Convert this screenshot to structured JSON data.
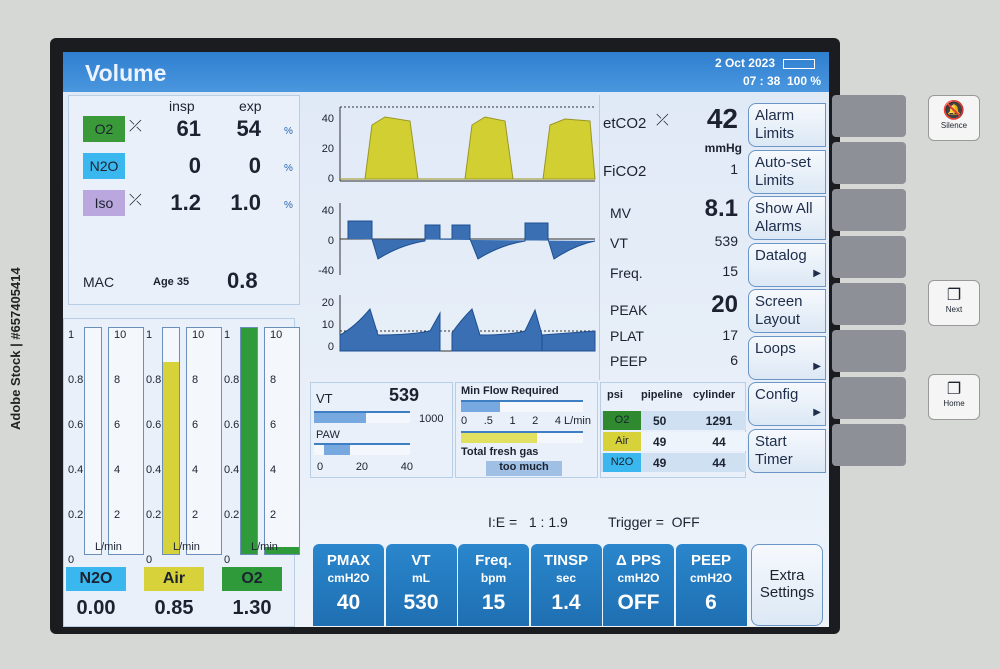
{
  "watermark": "Adobe Stock | #657405414",
  "header": {
    "title": "Volume",
    "date": "2 Oct 2023",
    "time": "07 : 38",
    "battery": "100 %"
  },
  "gases": {
    "col_insp": "insp",
    "col_exp": "exp",
    "unit": "%",
    "rows": [
      {
        "label": "O2",
        "insp": "61",
        "exp": "54",
        "color": "#3a9a3a"
      },
      {
        "label": "N2O",
        "insp": "0",
        "exp": "0",
        "color": "#39b7ee"
      },
      {
        "label": "Iso",
        "insp": "1.2",
        "exp": "1.0",
        "color": "#b9a7dd"
      }
    ],
    "mac_label": "MAC",
    "age": "Age 35",
    "mac": "0.8"
  },
  "flowmeters": {
    "unit": "L/min",
    "scale_left": [
      "1",
      "0.8",
      "0.6",
      "0.4",
      "0.2",
      "0"
    ],
    "scale_right": [
      "10",
      "8",
      "6",
      "4",
      "2"
    ],
    "tubes": [
      {
        "label": "N2O",
        "value": "0.00",
        "color": "#39b7ee",
        "level": 0
      },
      {
        "label": "Air",
        "value": "0.85",
        "color": "#d8d23a",
        "level": 0.85
      },
      {
        "label": "O2",
        "value": "1.30",
        "color": "#2f9a3a",
        "level": 1.0
      }
    ]
  },
  "waveforms": {
    "co2_ticks": [
      "40",
      "20",
      "0"
    ],
    "flow_ticks": [
      "40",
      "0",
      "-40"
    ],
    "paw_ticks": [
      "20",
      "10",
      "0"
    ]
  },
  "numerics": {
    "etco2_label": "etCO2",
    "etco2": "42",
    "etco2_unit": "mmHg",
    "fico2_label": "FiCO2",
    "fico2": "1",
    "mv_label": "MV",
    "mv": "8.1",
    "vt_label": "VT",
    "vt": "539",
    "freq_label": "Freq.",
    "freq": "15",
    "peak_label": "PEAK",
    "peak": "20",
    "plat_label": "PLAT",
    "plat": "17",
    "peep_label": "PEEP",
    "peep": "6"
  },
  "menu": [
    {
      "label": "Alarm Limits"
    },
    {
      "label": "Auto-set Limits"
    },
    {
      "label": "Show All Alarms"
    },
    {
      "label": "Datalog",
      "arrow": "▶"
    },
    {
      "label": "Screen Layout"
    },
    {
      "label": "Loops",
      "arrow": "▶"
    },
    {
      "label": "Config",
      "arrow": "▶"
    },
    {
      "label": "Start Timer"
    }
  ],
  "bars": {
    "vt_label": "VT",
    "vt": "539",
    "vt_max": "1000",
    "vt_fraction": 0.54,
    "paw_label": "PAW",
    "paw_ticks": [
      "0",
      "20",
      "40"
    ],
    "paw_fraction": 0.38,
    "minflow_label": "Min Flow Required",
    "minflow_ticks": [
      "0",
      ".5",
      "1",
      "2",
      "4 L/min"
    ],
    "fresh_label": "Total fresh gas",
    "fresh_status": "too much"
  },
  "supply": {
    "headers": [
      "psi",
      "pipeline",
      "cylinder"
    ],
    "rows": [
      {
        "gas": "O2",
        "pipeline": "50",
        "cylinder": "1291",
        "color": "#2f8a2f"
      },
      {
        "gas": "Air",
        "pipeline": "49",
        "cylinder": "44",
        "color": "#d8d23a"
      },
      {
        "gas": "N2O",
        "pipeline": "49",
        "cylinder": "44",
        "color": "#39b7ee"
      }
    ]
  },
  "status": {
    "ie_label": "I:E =",
    "ie": "1 : 1.9",
    "trigger_label": "Trigger =",
    "trigger": "OFF"
  },
  "settings": [
    {
      "l1": "PMAX",
      "l2": "cmH2O",
      "v": "40"
    },
    {
      "l1": "VT",
      "l2": "mL",
      "v": "530"
    },
    {
      "l1": "Freq.",
      "l2": "bpm",
      "v": "15"
    },
    {
      "l1": "TINSP",
      "l2": "sec",
      "v": "1.4"
    },
    {
      "l1": "Δ PPS",
      "l2": "cmH2O",
      "v": "OFF"
    },
    {
      "l1": "PEEP",
      "l2": "cmH2O",
      "v": "6"
    }
  ],
  "extra_settings": "Extra Settings",
  "hard_keys": {
    "silence": "Silence",
    "next": "Next",
    "home": "Home"
  }
}
